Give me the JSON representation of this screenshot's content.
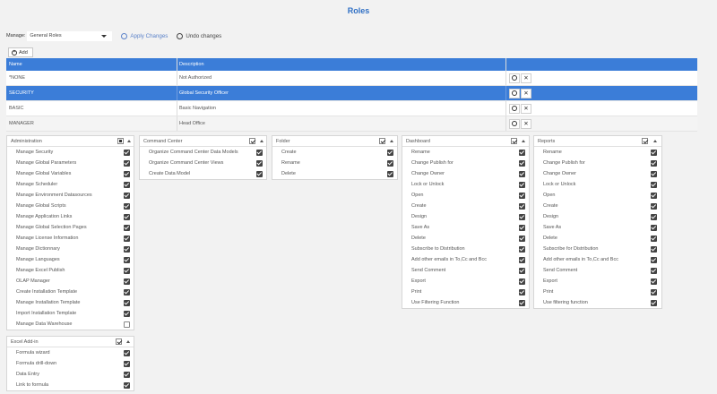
{
  "title": "Roles",
  "toolbar": {
    "manage_label": "Manage:",
    "manage_value": "General Roles",
    "apply_label": "Apply Changes",
    "undo_label": "Undo changes",
    "add_label": "Add"
  },
  "roles_table": {
    "headers": [
      "Name",
      "Description"
    ],
    "rows": [
      {
        "name": "*NONE",
        "description": "Not Authorized",
        "selected": false
      },
      {
        "name": "SECURITY",
        "description": "Global Security Officer",
        "selected": true
      },
      {
        "name": "BASIC",
        "description": "Basic Navigation",
        "selected": false
      },
      {
        "name": "MANAGER",
        "description": "Head Office",
        "selected": false
      }
    ]
  },
  "panels": {
    "administration": {
      "title": "Administration",
      "items": [
        {
          "label": "Manage Security",
          "checked": true
        },
        {
          "label": "Manage Global Parameters",
          "checked": true
        },
        {
          "label": "Manage Global Variables",
          "checked": true
        },
        {
          "label": "Manage Scheduler",
          "checked": true
        },
        {
          "label": "Manage Environment Datasources",
          "checked": true
        },
        {
          "label": "Manage Global Scripts",
          "checked": true
        },
        {
          "label": "Manage Application Links",
          "checked": true
        },
        {
          "label": "Manage Global Selection Pages",
          "checked": true
        },
        {
          "label": "Manage License Information",
          "checked": true
        },
        {
          "label": "Manage Dictionnary",
          "checked": true
        },
        {
          "label": "Manage Languages",
          "checked": true
        },
        {
          "label": "Manage Excel Publish",
          "checked": true
        },
        {
          "label": "OLAP Manager",
          "checked": true
        },
        {
          "label": "Create Installation Template",
          "checked": true
        },
        {
          "label": "Manage Installation Template",
          "checked": true
        },
        {
          "label": "Import Installation Template",
          "checked": true
        },
        {
          "label": "Manage Data Warehouse",
          "checked": false
        }
      ]
    },
    "command_center": {
      "title": "Command Center",
      "items": [
        {
          "label": "Organize Command Center Data Models",
          "checked": true
        },
        {
          "label": "Organize Command Center Views",
          "checked": true
        },
        {
          "label": "Create Data Model",
          "checked": true
        }
      ]
    },
    "folder": {
      "title": "Folder",
      "items": [
        {
          "label": "Create",
          "checked": true
        },
        {
          "label": "Rename",
          "checked": true
        },
        {
          "label": "Delete",
          "checked": true
        }
      ]
    },
    "dashboard": {
      "title": "Dashboard",
      "items": [
        {
          "label": "Rename",
          "checked": true
        },
        {
          "label": "Change Publish for",
          "checked": true
        },
        {
          "label": "Change Owner",
          "checked": true
        },
        {
          "label": "Lock or Unlock",
          "checked": true
        },
        {
          "label": "Open",
          "checked": true
        },
        {
          "label": "Create",
          "checked": true
        },
        {
          "label": "Design",
          "checked": true
        },
        {
          "label": "Save As",
          "checked": true
        },
        {
          "label": "Delete",
          "checked": true
        },
        {
          "label": "Subscribe to Distribution",
          "checked": true
        },
        {
          "label": "Add other emails in To,Cc and Bcc",
          "checked": true
        },
        {
          "label": "Send Comment",
          "checked": true
        },
        {
          "label": "Export",
          "checked": true
        },
        {
          "label": "Print",
          "checked": true
        },
        {
          "label": "Use Filtering Function",
          "checked": true
        }
      ]
    },
    "reports": {
      "title": "Reports",
      "items": [
        {
          "label": "Rename",
          "checked": true
        },
        {
          "label": "Change Publish for",
          "checked": true
        },
        {
          "label": "Change Owner",
          "checked": true
        },
        {
          "label": "Lock or Unlock",
          "checked": true
        },
        {
          "label": "Open",
          "checked": true
        },
        {
          "label": "Create",
          "checked": true
        },
        {
          "label": "Design",
          "checked": true
        },
        {
          "label": "Save As",
          "checked": true
        },
        {
          "label": "Delete",
          "checked": true
        },
        {
          "label": "Subscribe for Distribution",
          "checked": true
        },
        {
          "label": "Add other emails in To,Cc and Bcc",
          "checked": true
        },
        {
          "label": "Send Comment",
          "checked": true
        },
        {
          "label": "Export",
          "checked": true
        },
        {
          "label": "Print",
          "checked": true
        },
        {
          "label": "Use filtering function",
          "checked": true
        }
      ]
    },
    "excel_addin": {
      "title": "Excel Add-in",
      "items": [
        {
          "label": "Formula wizard",
          "checked": true
        },
        {
          "label": "Formula drill-down",
          "checked": true
        },
        {
          "label": "Data Entry",
          "checked": true
        },
        {
          "label": "Link to formula",
          "checked": true
        }
      ]
    }
  },
  "colors": {
    "accent": "#3b7dd8",
    "title": "#2f6fc4",
    "link": "#5b82c9"
  }
}
